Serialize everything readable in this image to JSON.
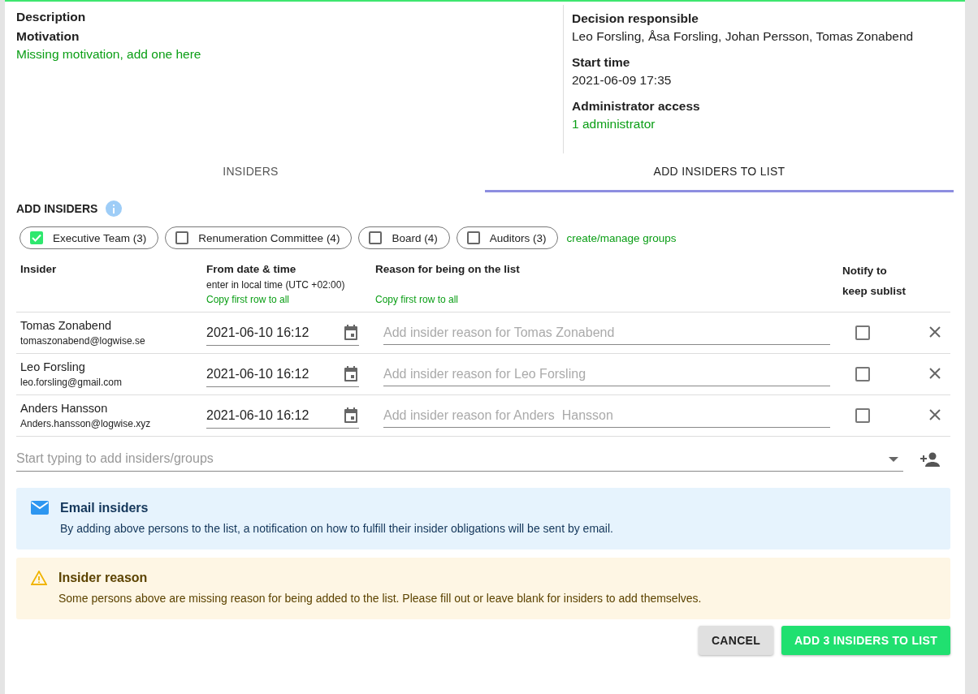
{
  "details": {
    "left": [
      {
        "label": "Description"
      },
      {
        "label": "Motivation",
        "link": "Missing motivation, add one here"
      }
    ],
    "right": [
      {
        "label": "Decision responsible",
        "value": "Leo Forsling, Åsa Forsling, Johan Persson, Tomas Zonabend"
      },
      {
        "label": "Start time",
        "value": "2021-06-09 17:35"
      },
      {
        "label": "Administrator access",
        "link": "1 administrator"
      }
    ]
  },
  "tabs": [
    {
      "label": "INSIDERS",
      "selected": false
    },
    {
      "label": "ADD INSIDERS TO LIST",
      "selected": true
    }
  ],
  "section_title": "ADD INSIDERS",
  "groups": [
    {
      "label": "Executive Team (3)",
      "checked": true
    },
    {
      "label": "Renumeration Committee (4)",
      "checked": false
    },
    {
      "label": "Board (4)",
      "checked": false
    },
    {
      "label": "Auditors (3)",
      "checked": false
    }
  ],
  "groups_link": "create/manage groups",
  "table": {
    "columns": [
      {
        "title": "Insider"
      },
      {
        "title": "From date & time",
        "hint": "enter in local time (UTC +02:00)",
        "link": "Copy first row to all"
      },
      {
        "title": "Reason for being on the list",
        "link": "Copy first row to all"
      },
      {
        "title": "Notify to keep sublist"
      }
    ],
    "rows": [
      {
        "name": "Tomas Zonabend",
        "email": "tomaszonabend@logwise.se",
        "date": "2021-06-10 16:12",
        "reason_placeholder": "Add insider reason for Tomas Zonabend",
        "notify": false
      },
      {
        "name": "Leo Forsling",
        "email": "leo.forsling@gmail.com",
        "date": "2021-06-10 16:12",
        "reason_placeholder": "Add insider reason for Leo Forsling",
        "notify": false
      },
      {
        "name": "Anders Hansson",
        "email": "Anders.hansson@logwise.xyz",
        "date": "2021-06-10 16:12",
        "reason_placeholder": "Add insider reason for Anders  Hansson",
        "notify": false
      }
    ]
  },
  "add_field": {
    "placeholder": "Start typing to add insiders/groups"
  },
  "alerts": [
    {
      "kind": "info",
      "title": "Email insiders",
      "text": "By adding above persons to the list, a notification on how to fulfill their insider obligations will be sent by email."
    },
    {
      "kind": "warning",
      "title": "Insider reason",
      "text": "Some persons above are missing reason for being added to the list. Please fill out or leave blank for insiders to add themselves."
    }
  ],
  "buttons": [
    {
      "label": "CANCEL",
      "kind": "secondary"
    },
    {
      "label": "ADD 3 INSIDERS TO LIST",
      "kind": "primary"
    }
  ]
}
